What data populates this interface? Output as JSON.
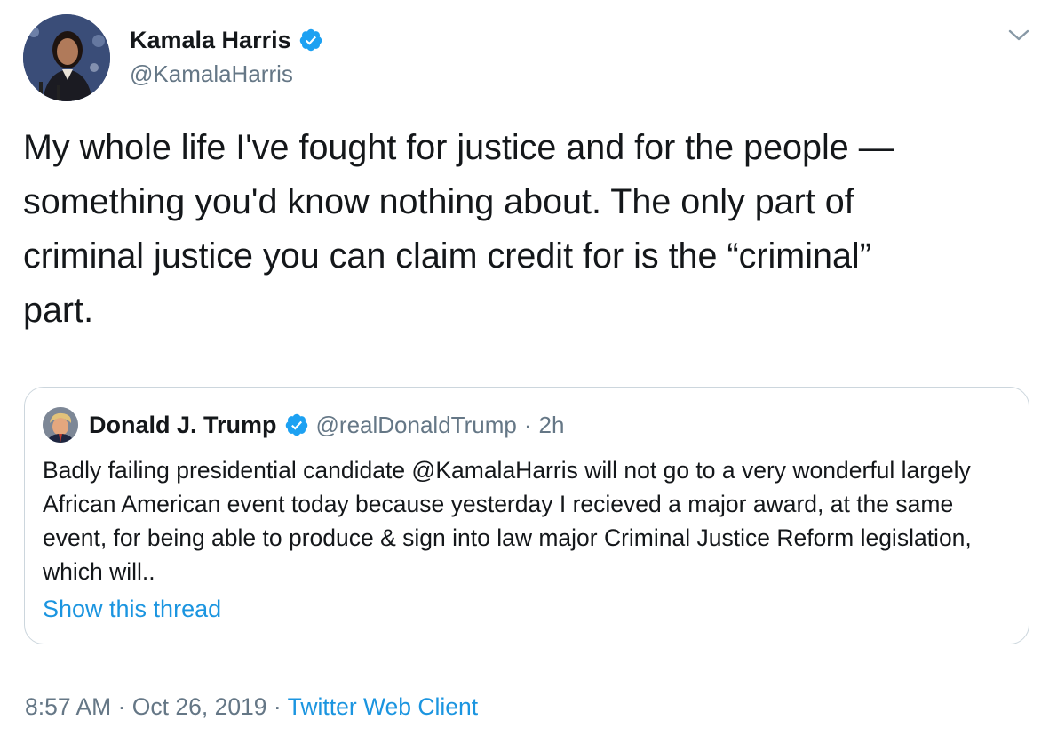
{
  "tweet": {
    "author": {
      "name": "Kamala Harris",
      "handle": "@KamalaHarris"
    },
    "text": "My whole life I've fought for justice and for the people —\nsomething you'd know nothing about. The only part of\ncriminal justice you can claim credit for is the “criminal”\npart.",
    "timestamp": "8:57 AM",
    "separator1": " · ",
    "date": "Oct 26, 2019",
    "separator2": " · ",
    "source": "Twitter Web Client"
  },
  "quoted_tweet": {
    "author": {
      "name": "Donald J. Trump",
      "handle": "@realDonaldTrump"
    },
    "separator": "·",
    "time": "2h",
    "text": "Badly failing presidential candidate @KamalaHarris will not go to a very wonderful largely African American event today because yesterday I recieved a major award, at the same event, for being able to produce & sign into law major Criminal Justice Reform legislation, which will..",
    "show_thread_label": "Show this thread"
  },
  "colors": {
    "text_primary": "#14171a",
    "text_secondary": "#657786",
    "link": "#1b95e0",
    "verified": "#1da1f2",
    "card_border": "#ccd6dd"
  },
  "icons": {
    "verified": "verified-badge-icon",
    "menu": "chevron-down-icon"
  }
}
